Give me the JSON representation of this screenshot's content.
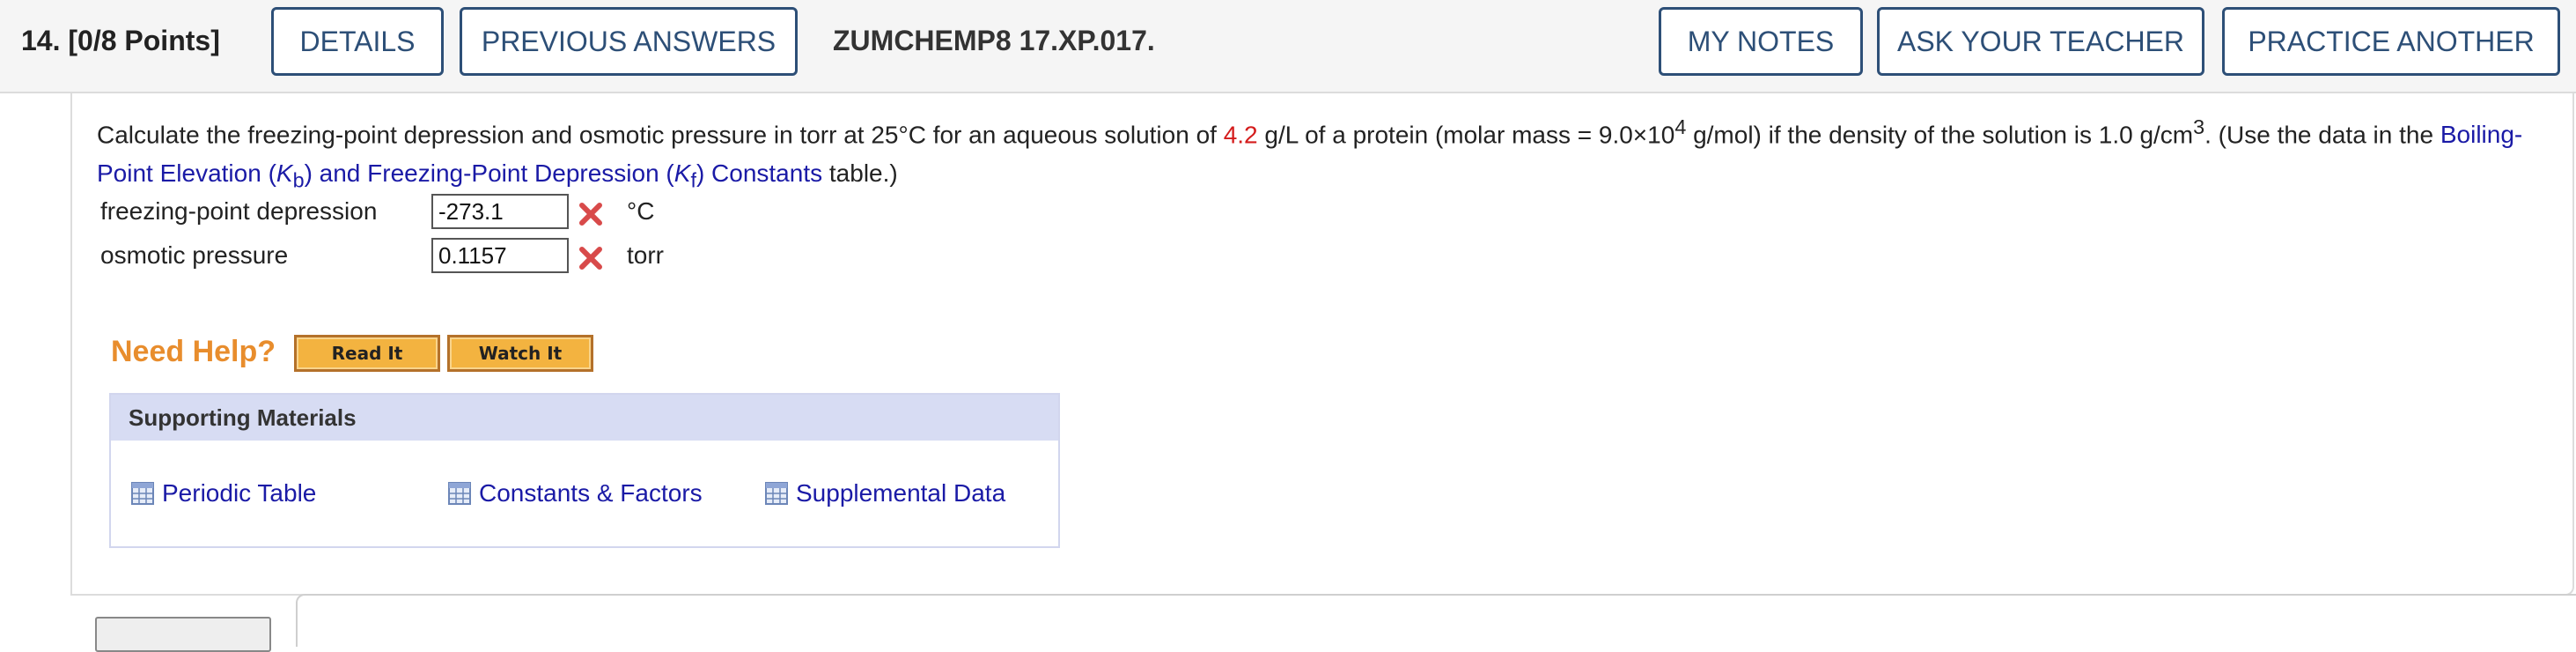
{
  "header": {
    "question_number": "14.",
    "points": "[0/8 Points]",
    "details_label": "DETAILS",
    "previous_answers_label": "PREVIOUS ANSWERS",
    "problem_code": "ZUMCHEMP8 17.XP.017.",
    "my_notes_label": "MY NOTES",
    "ask_teacher_label": "ASK YOUR TEACHER",
    "practice_another_label": "PRACTICE ANOTHER"
  },
  "question": {
    "text_1": "Calculate the freezing-point depression and osmotic pressure in torr at 25°C for an aqueous solution of ",
    "highlight_value": "4.2",
    "text_2": " g/L of a protein (molar mass = 9.0×10",
    "exp_4": "4",
    "text_3": " g/mol) if the density of the solution is 1.0 g/cm",
    "exp_3": "3",
    "text_4": ". (Use the data in the ",
    "link_1": "Boiling-Point Elevation (",
    "link_kb": "K",
    "link_kb_sub": "b",
    "link_2": ") and Freezing-Point Depression (",
    "link_kf": "K",
    "link_kf_sub": "f",
    "link_3": ") Constants",
    "text_5": " table.)"
  },
  "answers": [
    {
      "label": "freezing-point depression",
      "value": "-273.1",
      "unit": "°C",
      "status": "incorrect"
    },
    {
      "label": "osmotic pressure",
      "value": "0.1157",
      "unit": "torr",
      "status": "incorrect"
    }
  ],
  "help": {
    "title": "Need Help?",
    "read_it": "Read It",
    "watch_it": "Watch It"
  },
  "supporting": {
    "heading": "Supporting Materials",
    "items": [
      {
        "label": "Periodic Table",
        "icon": "table-icon"
      },
      {
        "label": "Constants & Factors",
        "icon": "table-icon"
      },
      {
        "label": "Supplemental Data",
        "icon": "table-icon"
      }
    ]
  },
  "colors": {
    "header_button": "#2d4f77",
    "link": "#1a1aa6",
    "highlight": "#d41c1c",
    "need_help": "#e88d2d",
    "help_button": "#f3b340",
    "support_header": "#d7dcf3"
  }
}
